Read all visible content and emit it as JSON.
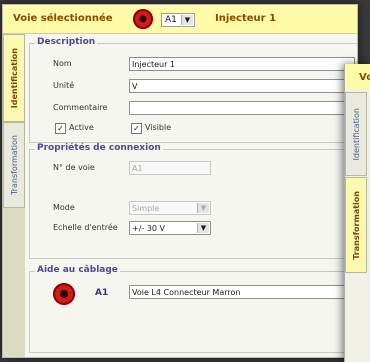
{
  "header": {
    "selected_channel_label": "Voie sélectionnée",
    "channel_combo_value": "A1",
    "channel_name": "Injecteur 1"
  },
  "tabs": {
    "identification": "Identification",
    "transformation": "Transformation"
  },
  "description": {
    "title": "Description",
    "name_label": "Nom",
    "name_value": "Injecteur 1",
    "unit_label": "Unité",
    "unit_value": "V",
    "comment_label": "Commentaire",
    "comment_value": "",
    "active_label": "Active",
    "active_checked": true,
    "visible_label": "Visible",
    "visible_checked": true
  },
  "connection": {
    "title": "Propriétés de connexion",
    "channel_number_label": "N° de voie",
    "channel_number_value": "A1",
    "mode_label": "Mode",
    "mode_value": "Simple",
    "input_scale_label": "Echelle d'entrée",
    "input_scale_value": "+/- 30 V"
  },
  "wiring": {
    "title": "Aide au câblage",
    "pin_label": "A1",
    "pin_description": "Voie L4 Connecteur Marron"
  },
  "second_window": {
    "header_text": "Vo",
    "tab_identification": "Identification",
    "tab_transformation": "Transformation"
  },
  "colors": {
    "header_bg": "#fffaa7",
    "header_text": "#8a4a00",
    "section_title": "#54469a",
    "indicator_red": "#d11c1c"
  }
}
